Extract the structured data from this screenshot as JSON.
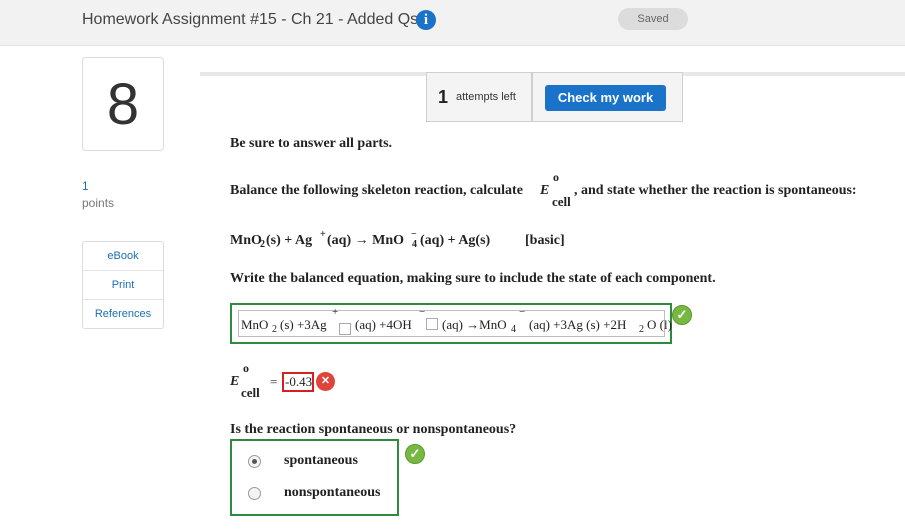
{
  "header": {
    "title": "Homework Assignment #15 - Ch 21 - Added Qs",
    "info_icon": "i",
    "status": "Saved"
  },
  "question": {
    "number": "8",
    "points_value": "1",
    "points_label": "points"
  },
  "side_links": [
    "eBook",
    "Print",
    "References"
  ],
  "toolbar": {
    "attempts_count": "1",
    "attempts_label": "attempts left",
    "check_button": "Check my work"
  },
  "prompts": {
    "be_sure": "Be sure to answer all parts.",
    "balance_pre": "Balance the following skeleton reaction, calculate",
    "balance_post": ", and state whether the reaction is spontaneous:",
    "ecell_symbol": "E",
    "ecell_sup": "o",
    "ecell_sub": "cell",
    "write_equation": "Write the balanced equation, making sure to include the state of each component.",
    "spontaneous_question": "Is the reaction spontaneous or nonspontaneous?"
  },
  "skeleton_reaction": {
    "left": "MnO",
    "left_sub": "2",
    "middle": "(s) + Ag",
    "middle_sup": "+",
    "after_ag": "(aq) → MnO",
    "mno4_sub": "4",
    "mno4_sup": "−",
    "tail": "(aq) + Ag(s)",
    "condition": "[basic]"
  },
  "balanced_equation": {
    "part1": "MnO",
    "sub1": "2",
    "part2": "(s) +3Ag",
    "ag_charge": "+",
    "part3": "(aq) +4OH",
    "oh_charge": "−",
    "part4": "(aq) →MnO",
    "sub4": "4",
    "mno4_charge": "−",
    "part5": "(aq) +3Ag (s) +2H",
    "sub_h": "2",
    "part6": "O (l)"
  },
  "ecell_answer": {
    "equals": "=",
    "value": "-0.43"
  },
  "choices": {
    "options": [
      "spontaneous",
      "nonspontaneous"
    ],
    "selected": "spontaneous"
  },
  "feedback": {
    "correct_mark": "✓",
    "incorrect_mark": "✕"
  },
  "colors": {
    "accent_blue": "#1a73c9",
    "correct_green": "#2d8a3e",
    "check_green": "#77b843",
    "incorrect_red": "#d32020"
  }
}
